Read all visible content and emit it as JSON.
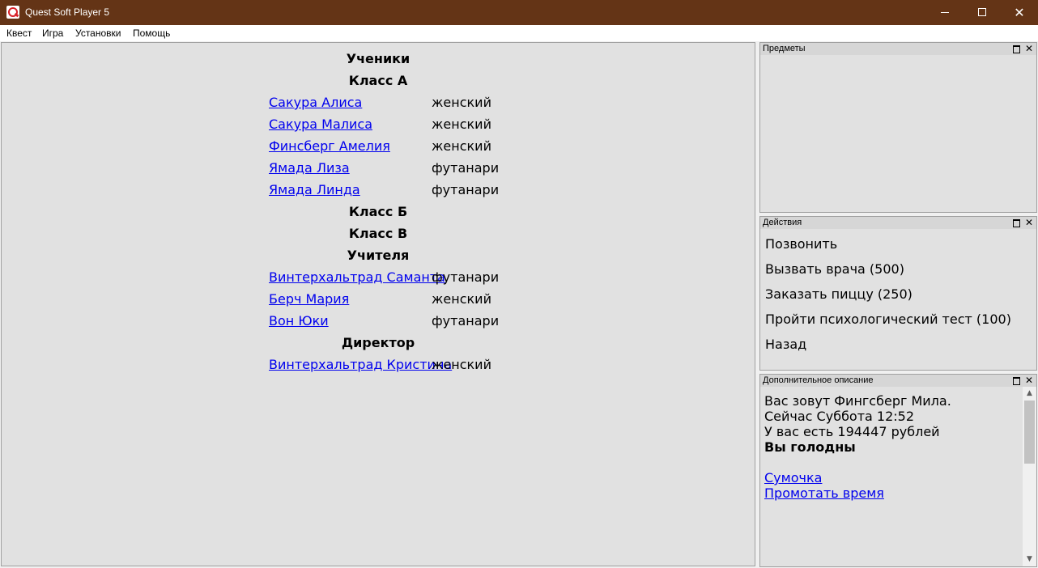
{
  "window": {
    "title": "Quest Soft Player 5",
    "controls": {
      "minimize": "",
      "maximize": "",
      "close": "✕"
    }
  },
  "menu": [
    "Квест",
    "Игра",
    "Установки",
    "Помощь"
  ],
  "main": {
    "headings": [
      "Ученики",
      "Класс А",
      "Класс Б",
      "Класс В",
      "Учителя",
      "Директор"
    ],
    "students_a": [
      {
        "name": "Сакура Алиса",
        "gender": "женский"
      },
      {
        "name": "Сакура Малиса",
        "gender": "женский"
      },
      {
        "name": "Финсберг Амелия",
        "gender": "женский"
      },
      {
        "name": "Ямада Лиза",
        "gender": "футанари"
      },
      {
        "name": "Ямада Линда",
        "gender": "футанари"
      }
    ],
    "teachers": [
      {
        "name": "Винтерхальтрад Саманта",
        "gender": "футанари"
      },
      {
        "name": "Берч Мария",
        "gender": "женский"
      },
      {
        "name": "Вон Юки",
        "gender": "футанари"
      }
    ],
    "director": [
      {
        "name": "Винтерхальтрад Кристина",
        "gender": "женский"
      }
    ]
  },
  "panels": {
    "items": {
      "title": "Предметы"
    },
    "actions": {
      "title": "Действия",
      "list": [
        "Позвонить",
        "Вызвать врача (500)",
        "Заказать пиццу (250)",
        "Пройти психологический тест (100)",
        "Назад"
      ]
    },
    "description": {
      "title": "Дополнительное описание",
      "lines": [
        "Вас зовут Фингсберг Мила.",
        "Сейчас Суббота 12:52",
        "У вас есть 194447 рублей",
        "Вы голодны"
      ],
      "links": [
        "Сумочка",
        "Промотать время"
      ]
    },
    "dock_icon": "dock-icon",
    "close_icon": "✕"
  },
  "colors": {
    "titlebar": "#643416",
    "panel_bg": "#e1e1e1",
    "link": "#0000ee"
  }
}
